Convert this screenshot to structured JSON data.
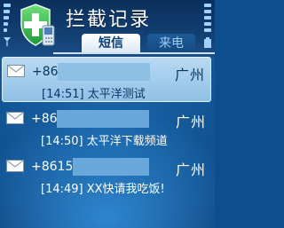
{
  "app": {
    "title": "拦截记录"
  },
  "tabs": [
    {
      "label": "短信",
      "active": true
    },
    {
      "label": "来电",
      "active": false
    }
  ],
  "messages": [
    {
      "number": "+86",
      "location": "广州",
      "time_text": "[14:51] 太平洋测试",
      "selected": true
    },
    {
      "number": "+86",
      "location": "广州",
      "time_text": "[14:50] 太平洋下载频道",
      "selected": false
    },
    {
      "number": "+8615",
      "location": "广州",
      "time_text": "[14:49] XX快请我吃饭!",
      "selected": false
    }
  ],
  "icons": {
    "app": "shield-phone-icon",
    "message": "envelope-icon",
    "signal": "signal-strength-icon",
    "battery": "battery-icon"
  },
  "colors": {
    "background": "#0d4f8e",
    "selected_row": "#a9d0ee",
    "text": "#ffffff",
    "selected_text": "#0b3765"
  }
}
